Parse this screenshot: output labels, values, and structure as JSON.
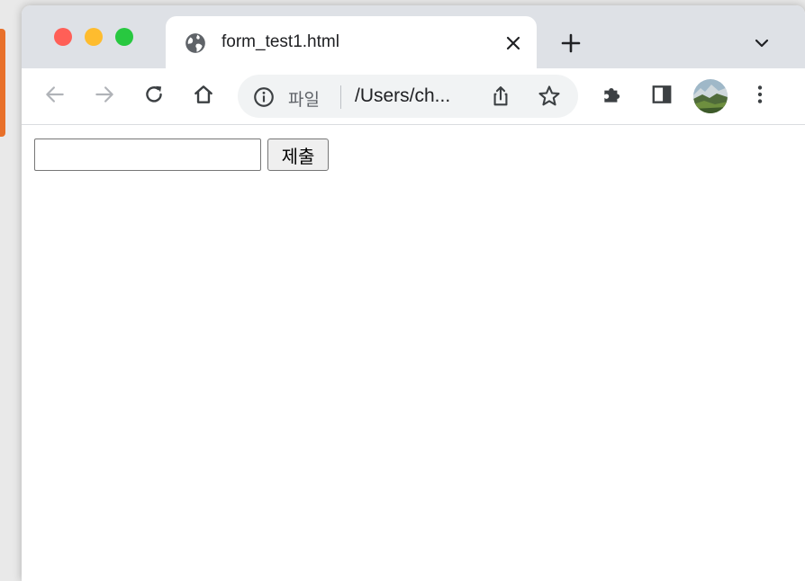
{
  "tab": {
    "title": "form_test1.html"
  },
  "omnibox": {
    "scheme_label": "파일",
    "url": "/Users/ch..."
  },
  "form": {
    "input_value": "",
    "submit_label": "제출"
  },
  "colors": {
    "traffic_close": "#ff5f57",
    "traffic_min": "#febc2e",
    "traffic_max": "#28c840",
    "tabstrip_bg": "#dee1e6",
    "icon_gray": "#5f6368"
  },
  "icons": {
    "tab_favicon": "globe-icon",
    "back": "arrow-left-icon",
    "forward": "arrow-right-icon",
    "reload": "reload-icon",
    "home": "home-icon",
    "site_info": "info-icon",
    "share": "share-icon",
    "bookmark": "star-icon",
    "extensions": "puzzle-icon",
    "side_panel": "side-panel-icon",
    "menu": "kebab-menu-icon"
  }
}
